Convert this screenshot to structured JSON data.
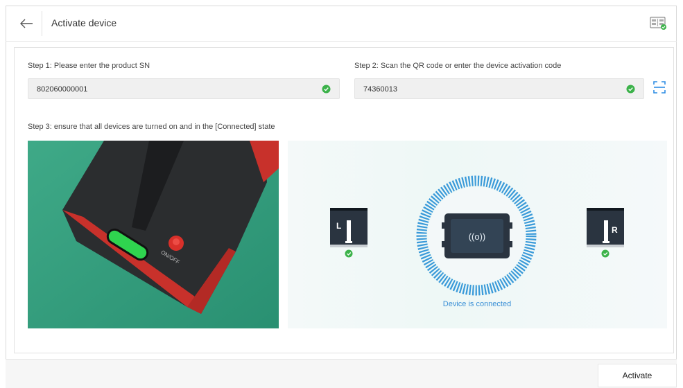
{
  "header": {
    "title": "Activate device"
  },
  "step1": {
    "label": "Step 1: Please enter the product SN",
    "value": "802060000001"
  },
  "step2": {
    "label": "Step 2: Scan the QR code or enter the device activation code",
    "value": "74360013"
  },
  "step3": {
    "label": "Step 3: ensure that all devices are turned on and in the [Connected] state"
  },
  "photo": {
    "switch_text": "ON/OFF"
  },
  "devices": {
    "left_label": "L",
    "right_label": "R",
    "hub_symbol": "((o))",
    "status": "Device is connected"
  },
  "footer": {
    "activate_label": "Activate"
  },
  "icons": {
    "back": "arrow-left-icon",
    "device_settings": "device-grid-icon",
    "check": "check-circle-icon",
    "scan": "scan-icon"
  },
  "colors": {
    "accent": "#3a8fd6",
    "ok_green": "#3cb24a",
    "ring_blue": "#3a9ad9",
    "device_dark": "#2a3440"
  }
}
